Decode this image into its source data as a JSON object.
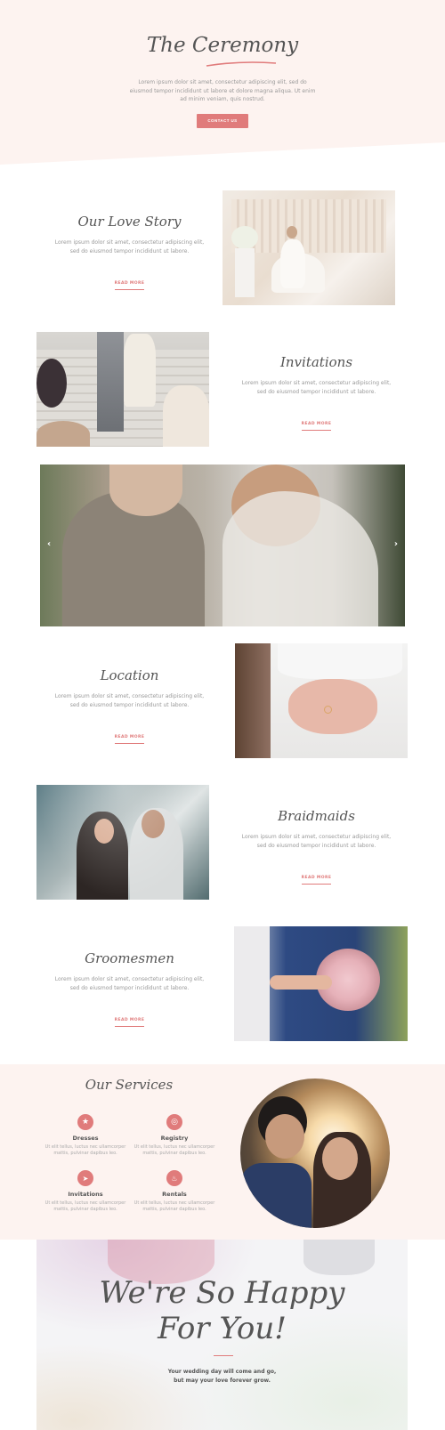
{
  "hero": {
    "title": "The Ceremony",
    "text": "Lorem ipsum dolor sit amet, consectetur adipiscing elit, sed do eiusmod tempor incididunt ut labore et dolore magna aliqua. Ut enim ad minim veniam, quis nostrud.",
    "button": "CONTACT US"
  },
  "sections": [
    {
      "title": "Our Love Story",
      "text": "Lorem ipsum dolor sit amet, consectetur adipiscing elit, sed do eiusmod tempor incididunt ut labore.",
      "link": "READ MORE"
    },
    {
      "title": "Invitations",
      "text": "Lorem ipsum dolor sit amet, consectetur adipiscing elit, sed do eiusmod tempor incididunt ut labore.",
      "link": "READ MORE"
    },
    {
      "title": "Location",
      "text": "Lorem ipsum dolor sit amet, consectetur adipiscing elit, sed do eiusmod tempor incididunt ut labore.",
      "link": "READ MORE"
    },
    {
      "title": "Braidmaids",
      "text": "Lorem ipsum dolor sit amet, consectetur adipiscing elit, sed do eiusmod tempor incididunt ut labore.",
      "link": "READ MORE"
    },
    {
      "title": "Groomesmen",
      "text": "Lorem ipsum dolor sit amet, consectetur adipiscing elit, sed do eiusmod tempor incididunt ut labore.",
      "link": "READ MORE"
    }
  ],
  "slider": {
    "prev": "‹",
    "next": "›"
  },
  "services": {
    "title": "Our Services",
    "items": [
      {
        "name": "Dresses",
        "icon": "star-icon",
        "glyph": "★",
        "text": "Ut elit tellus, luctus nec ullamcorper mattis, pulvinar dapibus leo."
      },
      {
        "name": "Registry",
        "icon": "rings-icon",
        "glyph": "◎",
        "text": "Ut elit tellus, luctus nec ullamcorper mattis, pulvinar dapibus leo."
      },
      {
        "name": "Invitations",
        "icon": "paper-plane-icon",
        "glyph": "➤",
        "text": "Ut elit tellus, luctus nec ullamcorper mattis, pulvinar dapibus leo."
      },
      {
        "name": "Rentals",
        "icon": "cake-icon",
        "glyph": "♨",
        "text": "Ut elit tellus, luctus nec ullamcorper mattis, pulvinar dapibus leo."
      }
    ]
  },
  "happy": {
    "line1": "We're So Happy",
    "line2": "For You!",
    "sub1": "Your wedding day will come and go,",
    "sub2": "but may your love forever grow."
  },
  "colors": {
    "accent": "#e07b7b",
    "blush": "#fdf3f0",
    "heading": "#555555"
  }
}
